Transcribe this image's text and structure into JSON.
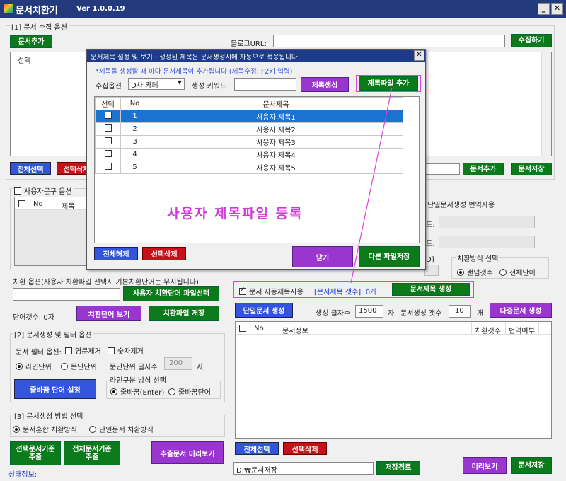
{
  "app": {
    "title": "문서치환기",
    "version": "Ver 1.0.0.19"
  },
  "window": {
    "minimize": "_",
    "close": "✕"
  },
  "collect": {
    "section": "[1] 문서 수집 옵션",
    "add_doc": "문서추가",
    "blog_url_label": "블로그URL:",
    "collect_btn": "수집하기",
    "col_select": "선택",
    "select_all": "전체선택",
    "delete_sel": "선택삭제",
    "add_doc2": "문서추가",
    "save_doc": "문서저장"
  },
  "user_phrase": {
    "section": "사용자문구 옵션",
    "col_no": "No",
    "col_title": "제목"
  },
  "translate": {
    "single_translate": "단일문서생성 번역사용",
    "e1": "드:",
    "e2": "드:",
    "e3": "D]"
  },
  "replace_opt": {
    "section": "치환방식 선택",
    "random_count": "랜덤갯수",
    "all_words": "전체단어"
  },
  "subst": {
    "section": "치환 옵션(사용자 치환파일 선택시 기본치환단어는 무시됩니다)",
    "user_file_btn": "사용자 치환단어 파일선택",
    "word_count": "단어갯수: 0자",
    "view_btn": "치환단어 보기",
    "save_btn": "치환파일 저장"
  },
  "gen_filter": {
    "section": "[2] 문서생성 및 필터 옵션",
    "filter_label": "문서 필터 옵션:",
    "eng_remove": "영문제거",
    "num_remove": "숫자제거",
    "line_unit": "라인단위",
    "para_unit": "문단단위",
    "para_count_label": "문단단위 글자수",
    "para_count_value": "200",
    "char": "자",
    "line_sep_label": "라인구분 방식 선택",
    "linebreak_enter": "줄바꿈(Enter)",
    "linebreak_word": "줄바꿈단어",
    "linebreak_btn": "줄바꿈 단어 설정"
  },
  "gen_method": {
    "section": "[3] 문서생성 방법 선택",
    "mixed": "문서혼합 치환방식",
    "single": "단일문서 치환방식"
  },
  "bottom_left": {
    "extract_sel": "선택문서기준\n추출",
    "extract_all": "전체문서기준\n추출",
    "preview": "추출문서 미리보기",
    "status": "상태정보:"
  },
  "auto_title": {
    "label": "문서 자동제목사용",
    "count": "[문서제목 갯수]: 0개",
    "gen_btn": "문서제목 생성"
  },
  "right": {
    "single_gen": "단일문서 생성",
    "gen_chars_label": "생성 글자수",
    "gen_chars": "1500",
    "char": "자",
    "gen_count_label": "문서생성 갯수",
    "gen_count": "10",
    "unit": "개",
    "multi_gen": "다중문서 생성",
    "col_no": "No",
    "col_info": "문서정보",
    "col_replace": "치환갯수",
    "col_trans": "번역여부",
    "select_all": "전체선택",
    "delete_sel": "선택삭제",
    "path": "D:₩문서저장",
    "path_btn": "저장경로",
    "preview": "미리보기",
    "save": "문서저장"
  },
  "dialog": {
    "title": "문서제목 설정 및 보기 : 생성된 제목은 문서생성시에 자동으로 적용됩니다",
    "close": "✕",
    "hint": "*제목을 생성할 때 마다 문서제목이 추가됩니다 (제목수정: F2키 입력)",
    "collect_opt_label": "수집옵션",
    "collect_opt_value": "D사 카페",
    "keyword_label": "생성 키워드",
    "gen_title": "제목생성",
    "add_title_file": "제목파일 추가",
    "col_select": "선택",
    "col_no": "No",
    "col_title": "문서제목",
    "rows": [
      {
        "no": "1",
        "title": "사용자 제목1"
      },
      {
        "no": "2",
        "title": "사용자 제목2"
      },
      {
        "no": "3",
        "title": "사용자 제목3"
      },
      {
        "no": "4",
        "title": "사용자 제목4"
      },
      {
        "no": "5",
        "title": "사용자 제목5"
      }
    ],
    "overlay": "사용자 제목파일 등록",
    "deselect_all": "전체해제",
    "delete_sel": "선택삭제",
    "close_btn": "닫기",
    "save_other": "다른 파일저장"
  },
  "colors": {
    "title_bar": "#233a7c",
    "green": "#0a7a1a",
    "blue": "#3355dd",
    "red": "#c8101a",
    "purple": "#9b35d0",
    "highlight": "#e040e0"
  }
}
